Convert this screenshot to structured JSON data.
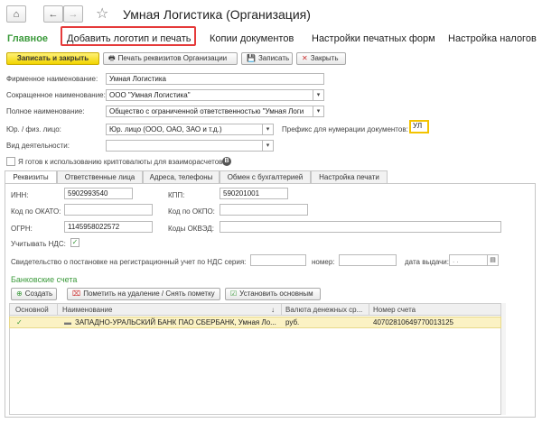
{
  "window": {
    "title": "Умная Логистика (Организация)",
    "home_icon": "home-icon",
    "back_icon": "arrow-left-icon",
    "forward_icon": "arrow-right-icon",
    "star_icon": "star-icon"
  },
  "tabs": [
    {
      "label": "Главное"
    },
    {
      "label": "Добавить логотип и печать"
    },
    {
      "label": "Копии документов"
    },
    {
      "label": "Настройки печатных форм"
    },
    {
      "label": "Настройка налогов"
    }
  ],
  "toolbar": {
    "save_close": "Записать и закрыть",
    "print_details": "Печать реквизитов Организации",
    "save": "Записать",
    "close": "Закрыть"
  },
  "form": {
    "brand_name_label": "Фирменное наименование:",
    "brand_name_value": "Умная Логистика",
    "short_name_label": "Сокращенное наименование:",
    "short_name_value": "ООО \"Умная Логистика\"",
    "full_name_label": "Полное наименование:",
    "full_name_value": "Общество с ограниченной ответственностью \"Умная Логи",
    "entity_type_label": "Юр. / физ. лицо:",
    "entity_type_value": "Юр. лицо (ООО, ОАО, ЗАО и т.д.)",
    "prefix_label": "Префикс для нумерации документов:",
    "prefix_value": "УЛ",
    "activity_label": "Вид деятельности:",
    "activity_value": "",
    "crypto_label": "Я готов к использованию криптовалюты для взаиморасчетов:",
    "crypto_icon": "bitcoin-icon"
  },
  "inner_tabs": [
    {
      "label": "Реквизиты"
    },
    {
      "label": "Ответственные лица"
    },
    {
      "label": "Адреса, телефоны"
    },
    {
      "label": "Обмен с бухгалтерией"
    },
    {
      "label": "Настройка печати"
    }
  ],
  "requisites": {
    "inn_label": "ИНН:",
    "inn_value": "5902993540",
    "kpp_label": "КПП:",
    "kpp_value": "590201001",
    "okato_label": "Код по ОКАТО:",
    "okato_value": "",
    "okpo_label": "Код по ОКПО:",
    "okpo_value": "",
    "ogrn_label": "ОГРН:",
    "ogrn_value": "1145958022572",
    "okved_label": "Коды ОКВЭД:",
    "okved_value": "",
    "vat_label": "Учитывать НДС:",
    "vat_checked": "✓",
    "cert_label": "Свидетельство о постановке на регистрационный учет по НДС серия:",
    "cert_number_label": "номер:",
    "cert_date_label": "дата выдачи:",
    "cert_date_placeholder": " .  .    "
  },
  "bank": {
    "section_title": "Банковские счета",
    "create": "Создать",
    "mark_delete": "Пометить на удаление / Снять пометку",
    "set_main": "Установить основным",
    "headers": {
      "main": "Основной",
      "name": "Наименование",
      "sort_arrow": "↓",
      "currency": "Валюта денежных ср...",
      "account": "Номер счета"
    },
    "rows": [
      {
        "main": "✓",
        "name": "ЗАПАДНО-УРАЛЬСКИЙ БАНК ПАО СБЕРБАНК, Умная Ло...",
        "currency": "руб.",
        "account": "40702810649770013125"
      }
    ]
  },
  "colors": {
    "accent_green": "#3b9a3b",
    "highlight_red": "#e53a3a",
    "primary_yellow": "#f1d400",
    "row_highlight": "#fbf2c4"
  }
}
